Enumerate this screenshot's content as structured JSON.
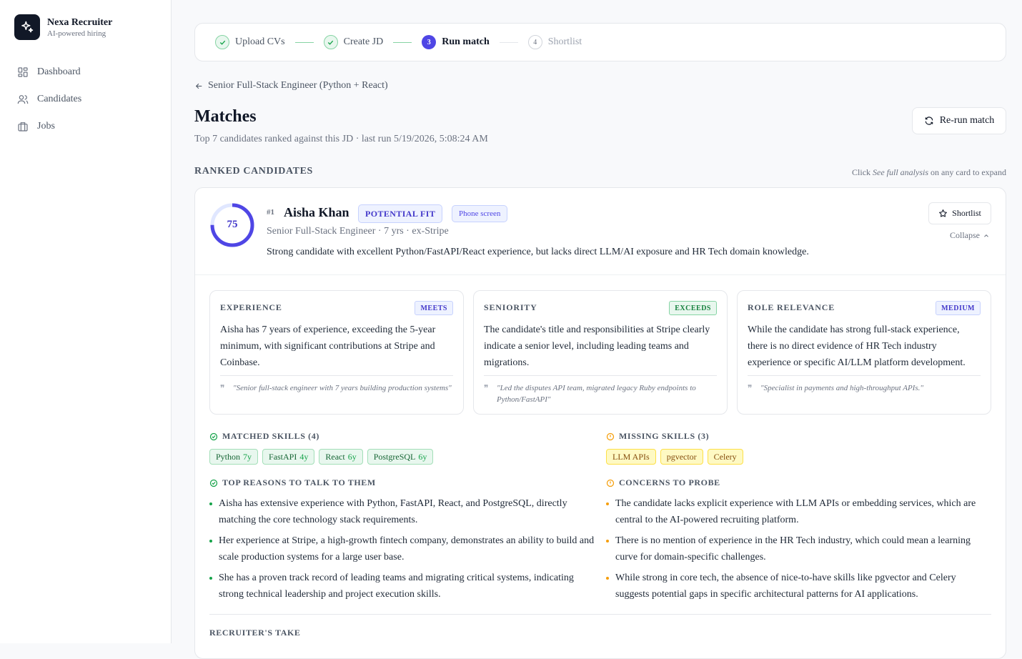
{
  "app": {
    "name": "Nexa Recruiter",
    "tagline": "AI-powered hiring"
  },
  "nav": [
    {
      "label": "Dashboard",
      "icon": "dashboard-icon"
    },
    {
      "label": "Candidates",
      "icon": "users-icon"
    },
    {
      "label": "Jobs",
      "icon": "briefcase-icon"
    }
  ],
  "stepper": [
    {
      "label": "Upload CVs",
      "state": "done"
    },
    {
      "label": "Create JD",
      "state": "done"
    },
    {
      "number": "3",
      "label": "Run match",
      "state": "active"
    },
    {
      "number": "4",
      "label": "Shortlist",
      "state": "todo"
    }
  ],
  "back_label": "Senior Full-Stack Engineer (Python + React)",
  "page": {
    "title": "Matches",
    "subtitle": "Top 7 candidates ranked against this JD · last run 5/19/2026, 5:08:24 AM",
    "rerun_label": "Re-run match",
    "section_title": "RANKED CANDIDATES",
    "hint_prefix": "Click ",
    "hint_em": "See full analysis",
    "hint_suffix": " on any card to expand"
  },
  "candidate": {
    "rank": "#1",
    "score": 75,
    "name": "Aisha Khan",
    "fit_badge": "POTENTIAL FIT",
    "stage_badge": "Phone screen",
    "meta": "Senior Full-Stack Engineer · 7 yrs · ex-Stripe",
    "summary": "Strong candidate with excellent Python/FastAPI/React experience, but lacks direct LLM/AI exposure and HR Tech domain knowledge.",
    "shortlist_label": "Shortlist",
    "collapse_label": "Collapse",
    "dimensions": [
      {
        "title": "EXPERIENCE",
        "badge": "MEETS",
        "text": "Aisha has 7 years of experience, exceeding the 5-year minimum, with significant contributions at Stripe and Coinbase.",
        "quote": "\"Senior full-stack engineer with 7 years building production systems\""
      },
      {
        "title": "SENIORITY",
        "badge": "EXCEEDS",
        "text": "The candidate's title and responsibilities at Stripe clearly indicate a senior level, including leading teams and migrations.",
        "quote": "\"Led the disputes API team, migrated legacy Ruby endpoints to Python/FastAPI\""
      },
      {
        "title": "ROLE RELEVANCE",
        "badge": "MEDIUM",
        "text": "While the candidate has strong full-stack experience, there is no direct evidence of HR Tech industry experience or specific AI/LLM platform development.",
        "quote": "\"Specialist in payments and high-throughput APIs.\""
      }
    ],
    "matched_title": "MATCHED SKILLS (4)",
    "matched_skills": [
      {
        "name": "Python",
        "years": "7y"
      },
      {
        "name": "FastAPI",
        "years": "4y"
      },
      {
        "name": "React",
        "years": "6y"
      },
      {
        "name": "PostgreSQL",
        "years": "6y"
      }
    ],
    "missing_title": "MISSING SKILLS (3)",
    "missing_skills": [
      "LLM APIs",
      "pgvector",
      "Celery"
    ],
    "reasons_title": "TOP REASONS TO TALK TO THEM",
    "reasons": [
      "Aisha has extensive experience with Python, FastAPI, React, and PostgreSQL, directly matching the core technology stack requirements.",
      "Her experience at Stripe, a high-growth fintech company, demonstrates an ability to build and scale production systems for a large user base.",
      "She has a proven track record of leading teams and migrating critical systems, indicating strong technical leadership and project execution skills."
    ],
    "concerns_title": "CONCERNS TO PROBE",
    "concerns": [
      "The candidate lacks explicit experience with LLM APIs or embedding services, which are central to the AI-powered recruiting platform.",
      "There is no mention of experience in the HR Tech industry, which could mean a learning curve for domain-specific challenges.",
      "While strong in core tech, the absence of nice-to-have skills like pgvector and Celery suggests potential gaps in specific architectural patterns for AI applications."
    ],
    "take_title": "RECRUITER'S TAKE"
  },
  "colors": {
    "accent": "#4f46e5",
    "success": "#16a34a",
    "warning": "#f59e0b"
  }
}
